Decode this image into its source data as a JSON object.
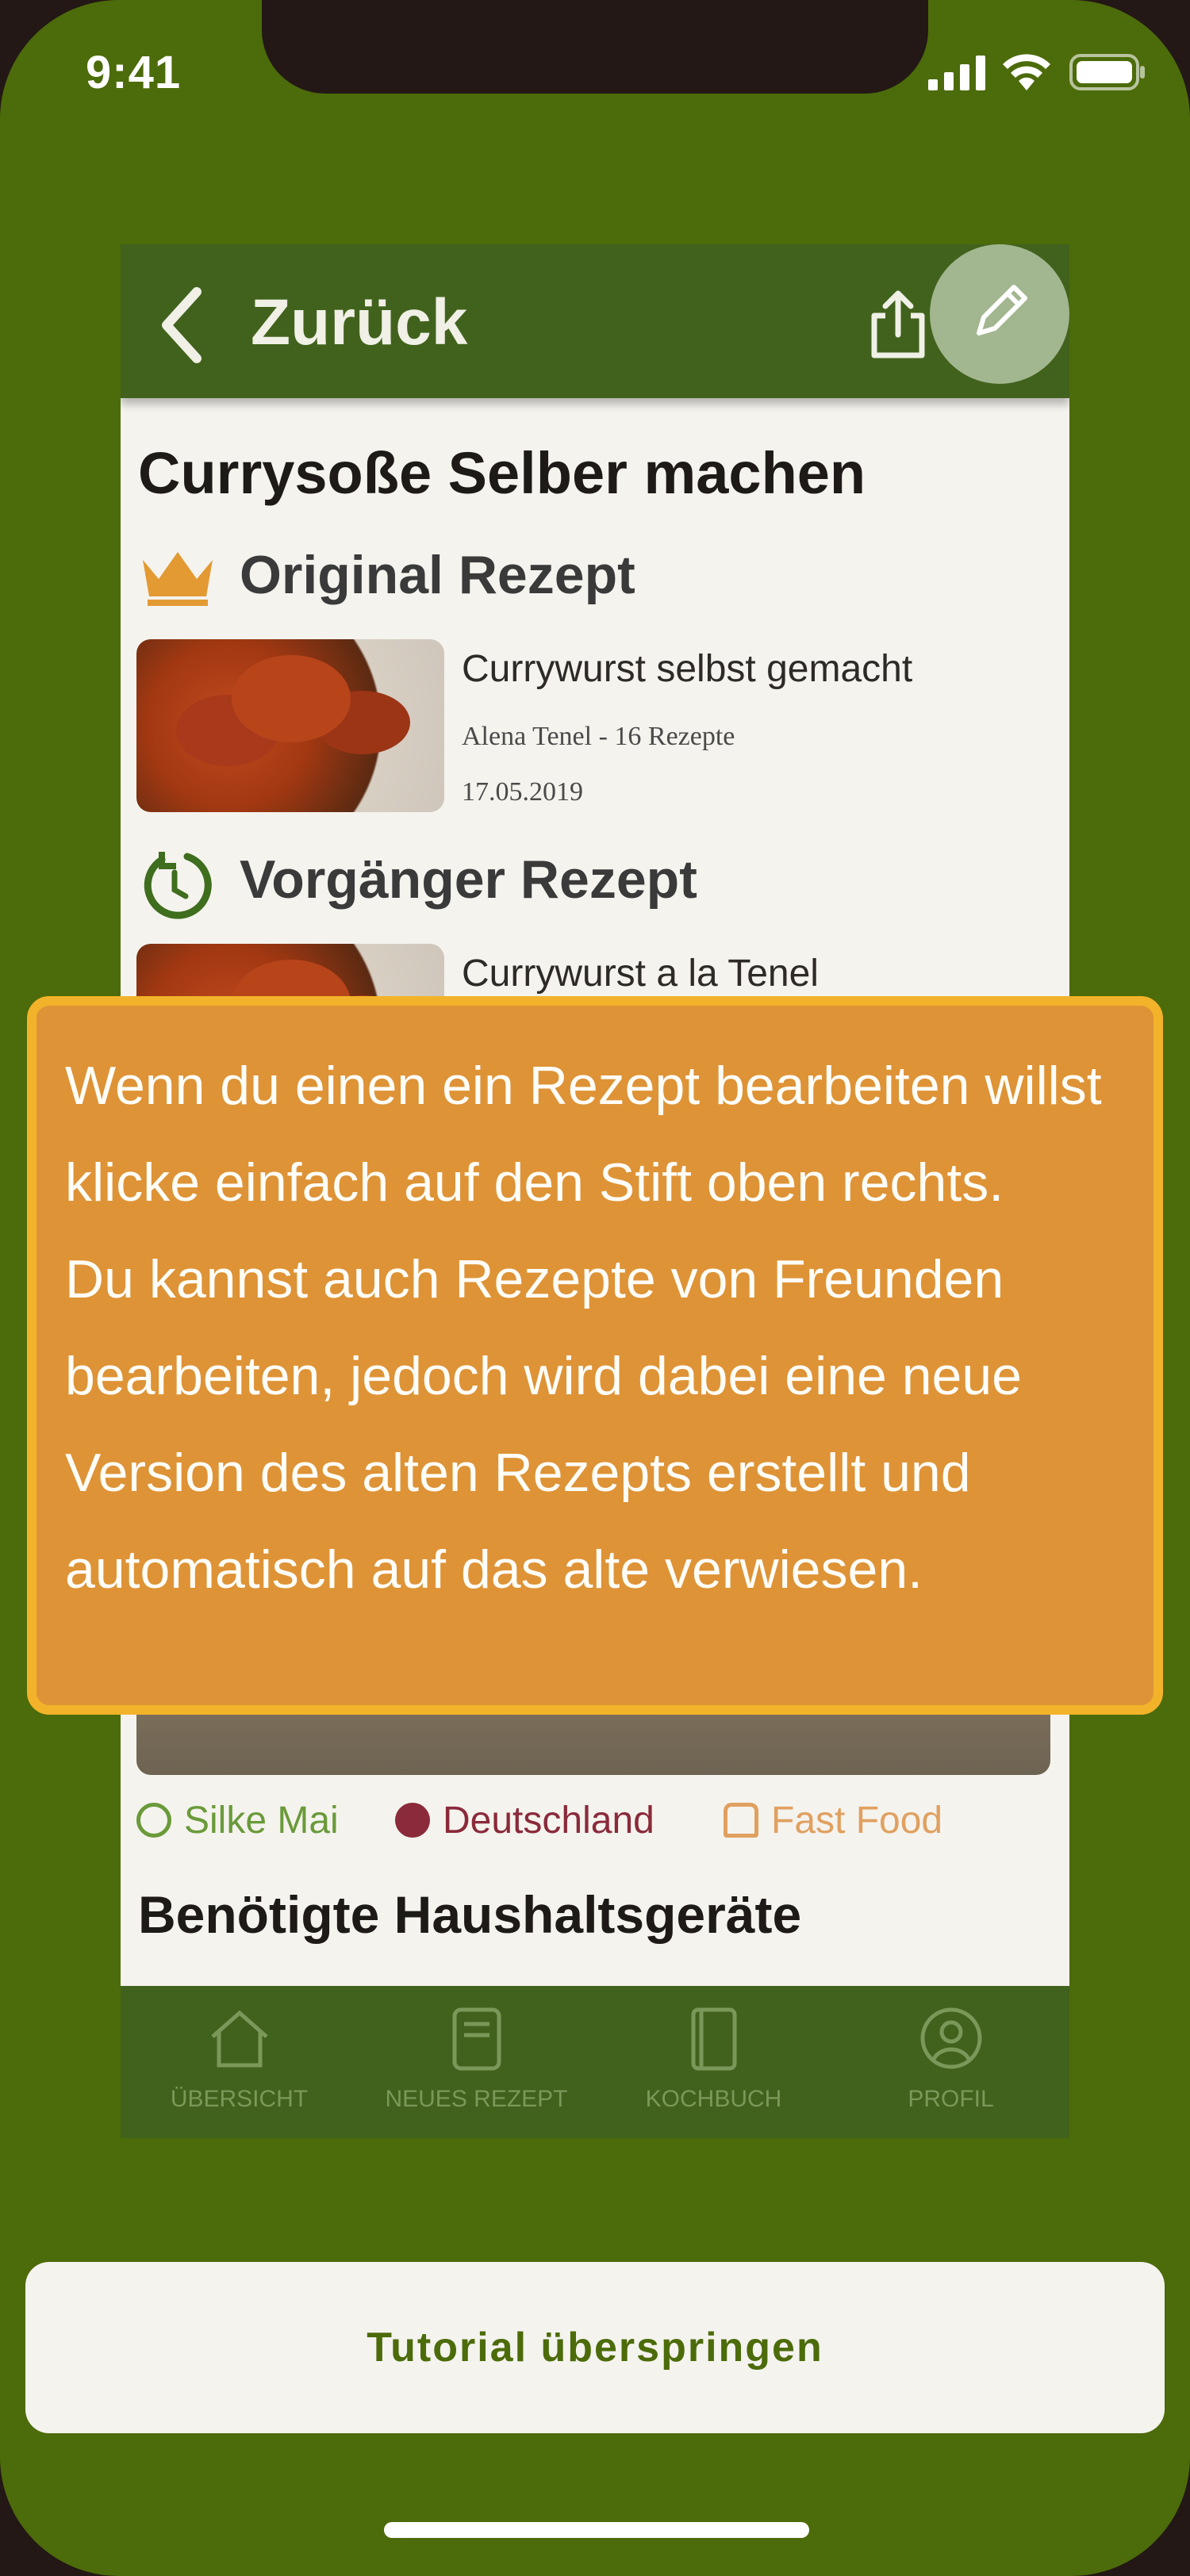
{
  "status_bar": {
    "time": "9:41"
  },
  "preview": {
    "header": {
      "back_label": "Zurück"
    },
    "title": "Currysoße Selber machen",
    "sections": {
      "original": "Original Rezept",
      "predecessor": "Vorgänger Rezept"
    },
    "recipes": [
      {
        "name": "Currywurst selbst gemacht",
        "author": "Alena Tenel - 16 Rezepte",
        "date": "17.05.2019"
      },
      {
        "name": "Currywurst a la Tenel"
      }
    ],
    "tags": [
      {
        "label": "Silke Mai",
        "color": "#6a9a3a"
      },
      {
        "label": "Deutschland",
        "color": "#8a2a3a"
      },
      {
        "label": "Fast Food",
        "color": "#e0a060"
      }
    ],
    "devices_title": "Benötigte Haushaltsgeräte",
    "nav": [
      {
        "label": "ÜBERSICHT",
        "icon": "home-icon"
      },
      {
        "label": "NEUES REZEPT",
        "icon": "new-recipe-icon"
      },
      {
        "label": "KOCHBUCH",
        "icon": "cookbook-icon"
      },
      {
        "label": "PROFIL",
        "icon": "profile-icon"
      }
    ]
  },
  "tooltip": {
    "line1": "Wenn du einen ein Rezept bearbeiten willst klicke einfach auf den Stift oben rechts.",
    "line2": "Du kannst auch Rezepte von Freunden bearbeiten, jedoch wird dabei eine neue Version des alten Rezepts erstellt und automatisch auf das alte verwiesen."
  },
  "skip_button": {
    "label": "Tutorial überspringen"
  },
  "colors": {
    "background": "#4c6b0a",
    "header": "#41621c",
    "tooltip": "#de9336",
    "tooltip_border": "#f2b32a"
  }
}
